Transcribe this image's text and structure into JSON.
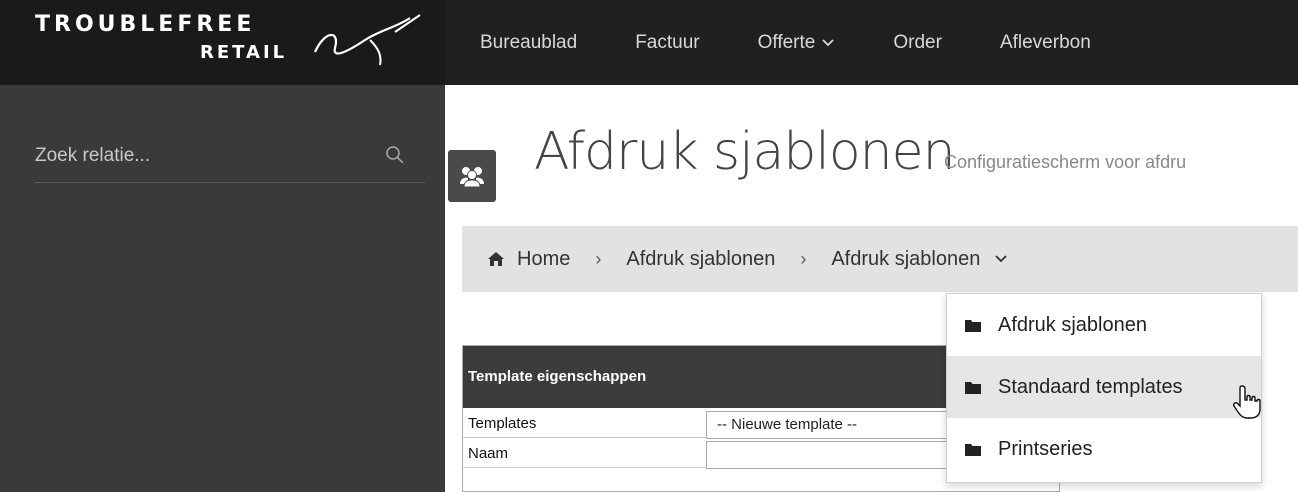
{
  "logo": {
    "line1": "TROUBLEFREE",
    "line2": "RETAIL"
  },
  "nav": {
    "items": [
      {
        "label": "Bureaublad"
      },
      {
        "label": "Factuur"
      },
      {
        "label": "Offerte"
      },
      {
        "label": "Order"
      },
      {
        "label": "Afleverbon"
      }
    ]
  },
  "search": {
    "placeholder": "Zoek relatie..."
  },
  "page": {
    "title": "Afdruk sjablonen",
    "subtitle": "Configuratiescherm voor afdru"
  },
  "breadcrumb": {
    "home": "Home",
    "level1": "Afdruk sjablonen",
    "level2": "Afdruk sjablonen"
  },
  "panel": {
    "title": "Template eigenschappen",
    "rows": [
      {
        "label": "Templates",
        "value": "-- Nieuwe template --"
      },
      {
        "label": "Naam",
        "value": ""
      }
    ]
  },
  "dropdown": {
    "items": [
      {
        "label": "Afdruk sjablonen"
      },
      {
        "label": "Standaard templates"
      },
      {
        "label": "Printseries"
      }
    ],
    "hovered_index": 1
  },
  "colors": {
    "topbar": "#202020",
    "sidebar": "#3a3a3a",
    "breadcrumb": "#e2e2e2",
    "panel_header": "#3c3c3c"
  }
}
